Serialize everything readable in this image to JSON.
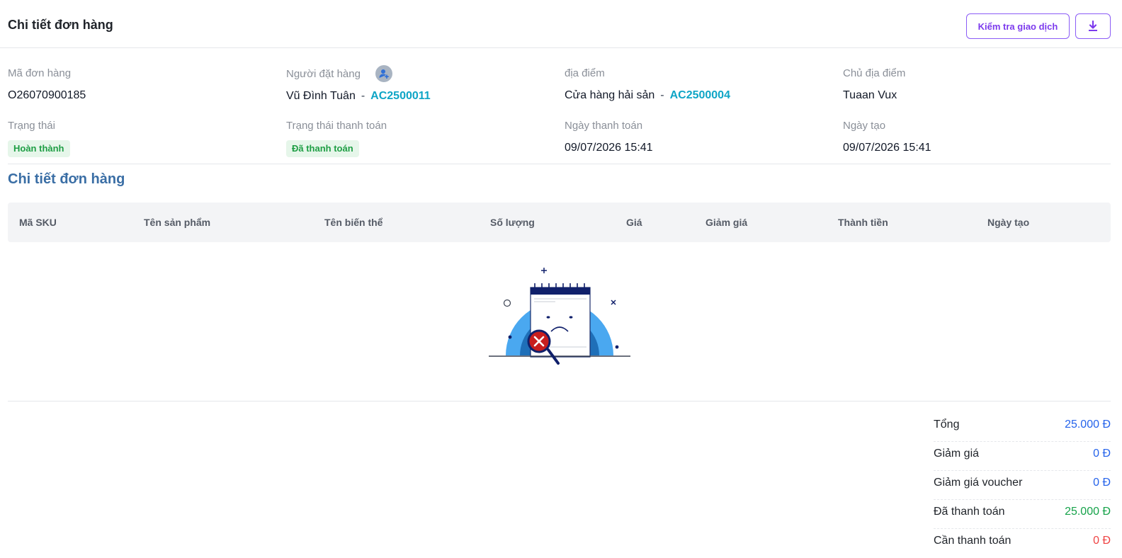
{
  "header": {
    "title": "Chi tiết đơn hàng",
    "check_button": "Kiểm tra giao dịch",
    "download_icon": "download-icon"
  },
  "info": {
    "order_code_label": "Mã đơn hàng",
    "order_code": "O26070900185",
    "orderer_label": "Người đặt hàng",
    "orderer_name": "Vũ Đình Tuân",
    "orderer_code": "AC2500011",
    "location_label": "địa điểm",
    "location_name": "Cửa hàng hải sản",
    "location_code": "AC2500004",
    "owner_label": "Chủ địa điểm",
    "owner_name": "Tuaan Vux",
    "status_label": "Trạng thái",
    "status": "Hoàn thành",
    "payment_status_label": "Trạng thái thanh toán",
    "payment_status": "Đã thanh toán",
    "payment_date_label": "Ngày thanh toán",
    "payment_date": "09/07/2026 15:41",
    "created_date_label": "Ngày tạo",
    "created_date": "09/07/2026 15:41",
    "separator": "-"
  },
  "details": {
    "title": "Chi tiết đơn hàng",
    "columns": [
      "Mã SKU",
      "Tên sản phẩm",
      "Tên biến thể",
      "Số lượng",
      "Giá",
      "Giảm giá",
      "Thành tiền",
      "Ngày tạo"
    ]
  },
  "summary": [
    {
      "label": "Tổng",
      "value": "25.000 Đ",
      "color": "#2563eb"
    },
    {
      "label": "Giảm giá",
      "value": "0 Đ",
      "color": "#2563eb"
    },
    {
      "label": "Giảm giá voucher",
      "value": "0 Đ",
      "color": "#2563eb"
    },
    {
      "label": "Đã thanh toán",
      "value": "25.000 Đ",
      "color": "#16a34a"
    },
    {
      "label": "Cần thanh toán",
      "value": "0 Đ",
      "color": "#ef4444"
    }
  ]
}
